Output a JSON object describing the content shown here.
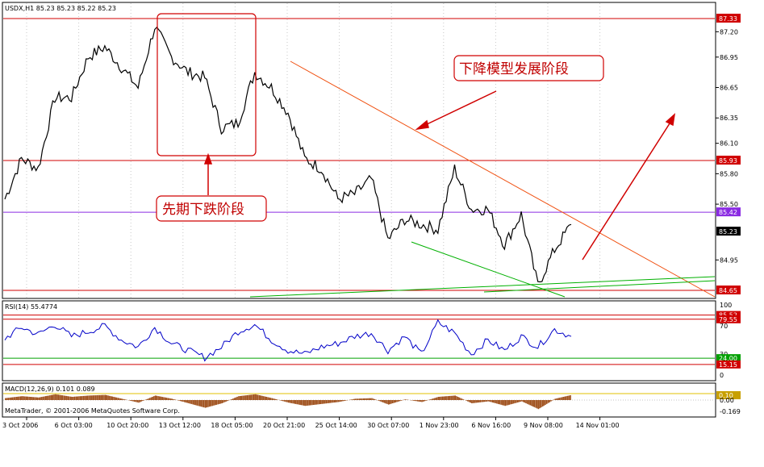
{
  "window": {
    "symbol_header": "USDX,H1  85.23 85.23 85.22 85.23",
    "rsi_header": "RSI(14) 55.4774",
    "macd_header": "MACD(12,26,9) 0.101 0.089",
    "copyright": "MetaTrader, © 2001-2006 MetaQuotes Software Corp."
  },
  "annotations": {
    "descent_label": "下降模型发展阶段",
    "prior_decline_label": "先期下跌阶段"
  },
  "price_axis": {
    "ticks": [
      "87.20",
      "86.95",
      "86.65",
      "86.35",
      "86.10",
      "85.80",
      "85.50",
      "85.23",
      "84.95"
    ],
    "tags": [
      {
        "label": "87.33",
        "value": 87.33,
        "color": "#d00000"
      },
      {
        "label": "85.93",
        "value": 85.93,
        "color": "#d00000"
      },
      {
        "label": "85.42",
        "value": 85.42,
        "color": "#8a2be2"
      },
      {
        "label": "85.23",
        "value": 85.23,
        "color": "#000000"
      },
      {
        "label": "84.65",
        "value": 84.65,
        "color": "#d00000"
      }
    ]
  },
  "rsi_axis": {
    "ticks": [
      "100",
      "70",
      "30",
      "0"
    ],
    "tags": [
      {
        "label": "85.52",
        "value": 85.52,
        "color": "#d00000"
      },
      {
        "label": "79.55",
        "value": 79.55,
        "color": "#d00000"
      },
      {
        "label": "24.00",
        "value": 24.0,
        "color": "#00a000"
      },
      {
        "label": "15.15",
        "value": 15.15,
        "color": "#d00000"
      }
    ]
  },
  "macd_axis": {
    "ticks": [
      "0.00",
      "-0.169"
    ],
    "tags": [
      {
        "label": "0.10",
        "value": 0.1,
        "color": "#c8a000"
      }
    ]
  },
  "time_axis": [
    "3 Oct 2006",
    "6 Oct 03:00",
    "10 Oct 20:00",
    "13 Oct 12:00",
    "18 Oct 05:00",
    "20 Oct 21:00",
    "25 Oct 14:00",
    "30 Oct 07:00",
    "1 Nov 23:00",
    "6 Nov 16:00",
    "9 Nov 08:00",
    "14 Nov 01:00"
  ],
  "colors": {
    "price_line": "#000000",
    "rsi_line": "#0000c0",
    "macd_hist": "#a0521e",
    "horizontal": "#d00000",
    "violet": "#8a2be2",
    "trend_down": "#f05010",
    "trend_green": "#00a000",
    "annotation": "#c00000"
  },
  "chart_data": [
    {
      "type": "line",
      "title": "USDX,H1",
      "series": [
        {
          "name": "USDX,H1",
          "x": [
            "3 Oct 2006",
            "4 Oct",
            "5 Oct",
            "6 Oct",
            "7 Oct",
            "9 Oct",
            "10 Oct",
            "11 Oct",
            "12 Oct",
            "13 Oct",
            "14 Oct",
            "16 Oct",
            "17 Oct",
            "18 Oct",
            "19 Oct",
            "20 Oct",
            "21 Oct",
            "23 Oct",
            "24 Oct",
            "25 Oct",
            "26 Oct",
            "27 Oct",
            "28 Oct",
            "30 Oct",
            "31 Oct",
            "1 Nov",
            "2 Nov",
            "3 Nov",
            "6 Nov",
            "7 Nov",
            "8 Nov",
            "9 Nov",
            "10 Nov",
            "13 Nov",
            "14 Nov"
          ],
          "values": [
            85.55,
            85.95,
            85.85,
            86.55,
            86.55,
            86.95,
            87.05,
            86.85,
            86.65,
            87.25,
            86.95,
            86.8,
            86.75,
            86.25,
            86.3,
            86.8,
            86.65,
            86.4,
            85.95,
            85.85,
            85.55,
            85.6,
            85.75,
            85.15,
            85.35,
            85.3,
            85.25,
            85.85,
            85.45,
            85.45,
            85.1,
            85.4,
            84.7,
            85.05,
            85.3
          ]
        }
      ],
      "ylim": [
        84.6,
        87.45
      ],
      "horizontal_lines": [
        87.33,
        85.93,
        85.42,
        84.65
      ]
    },
    {
      "type": "line",
      "title": "RSI(14)",
      "series": [
        {
          "name": "RSI(14)",
          "values": [
            52,
            68,
            58,
            72,
            55,
            62,
            70,
            50,
            40,
            68,
            45,
            35,
            25,
            40,
            62,
            72,
            50,
            35,
            30,
            40,
            45,
            55,
            60,
            35,
            55,
            30,
            75,
            60,
            30,
            50,
            35,
            55,
            40,
            65,
            55
          ]
        }
      ],
      "ylim": [
        0,
        100
      ],
      "levels": [
        85.52,
        79.55,
        24.0,
        15.15
      ]
    },
    {
      "type": "bar",
      "title": "MACD(12,26,9)",
      "series": [
        {
          "name": "MACD(12,26,9)",
          "values": [
            0.03,
            0.06,
            0.04,
            0.09,
            0.05,
            0.07,
            0.08,
            0.02,
            -0.04,
            0.07,
            0.02,
            -0.05,
            -0.12,
            -0.05,
            0.06,
            0.09,
            0.03,
            -0.04,
            -0.09,
            -0.06,
            -0.03,
            0.02,
            0.03,
            -0.07,
            0.01,
            -0.03,
            0.05,
            0.07,
            -0.05,
            -0.02,
            -0.09,
            -0.02,
            -0.14,
            0.02,
            0.08
          ]
        }
      ],
      "ylim": [
        -0.169,
        0.1
      ]
    }
  ]
}
